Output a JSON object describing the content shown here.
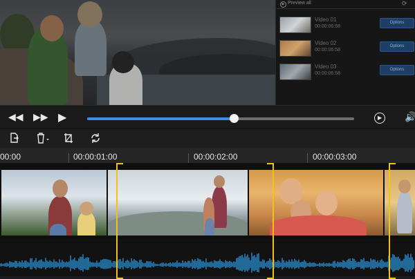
{
  "preview_panel": {
    "header_label": "Preview all",
    "videos": [
      {
        "name": "Video 01",
        "duration": "00:00:06:58",
        "options_label": "Options"
      },
      {
        "name": "Video 02",
        "duration": "00:00:06:58",
        "options_label": "Options"
      },
      {
        "name": "Video 03",
        "duration": "00:00:06:58",
        "options_label": "Options"
      }
    ]
  },
  "transport": {
    "progress": 0.55
  },
  "ruler": {
    "labels": [
      "00:00",
      "00:00:01:00",
      "00:00:02:00",
      "00:00:03:00"
    ]
  },
  "colors": {
    "accent": "#3d8ee8",
    "selection": "#f3c21a",
    "waveform": "#2a8fd0",
    "options_button": "#1d3f66"
  },
  "icons": {
    "rewind": "rewind-icon",
    "fast_forward": "fast-forward-icon",
    "play": "play-icon",
    "play_circle": "play-circle-icon",
    "volume": "volume-icon",
    "export": "export-icon",
    "delete": "trash-icon",
    "split": "split-icon",
    "rotate": "rotate-icon"
  }
}
